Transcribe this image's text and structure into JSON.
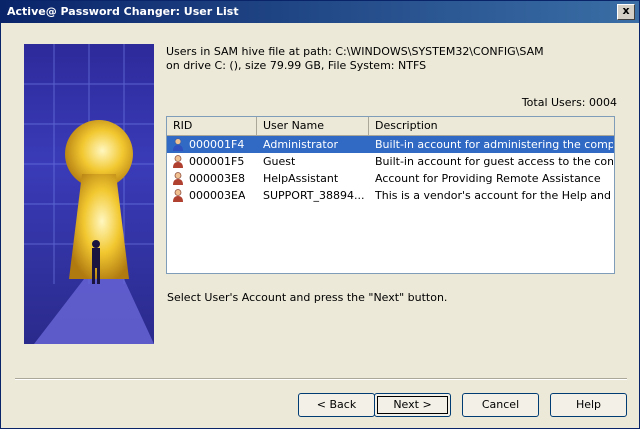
{
  "window": {
    "title": "Active@ Password Changer: User List",
    "close_label": "x"
  },
  "info": {
    "line1": "Users in SAM hive file at path: C:\\WINDOWS\\SYSTEM32\\CONFIG\\SAM",
    "line2": "on drive C: (), size 79.99 GB, File System: NTFS",
    "total": "Total Users: 0004"
  },
  "list": {
    "columns": [
      "RID",
      "User Name",
      "Description"
    ],
    "rows": [
      {
        "rid": "000001F4",
        "name": "Administrator",
        "desc": "Built-in account for administering the comput...",
        "icon": "user-admin-icon",
        "selected": true
      },
      {
        "rid": "000001F5",
        "name": "Guest",
        "desc": "Built-in account for guest access to the comp...",
        "icon": "user-icon",
        "selected": false
      },
      {
        "rid": "000003E8",
        "name": "HelpAssistant",
        "desc": "Account for Providing Remote Assistance",
        "icon": "user-icon",
        "selected": false
      },
      {
        "rid": "000003EA",
        "name": "SUPPORT_38894...",
        "desc": "This is a vendor's account for the Help and S...",
        "icon": "user-icon",
        "selected": false
      }
    ]
  },
  "hint": "Select User's Account and press the \"Next\" button.",
  "buttons": {
    "back": "< Back",
    "next": "Next >",
    "cancel": "Cancel",
    "help": "Help"
  },
  "colors": {
    "selection": "#316ac5",
    "title_start": "#0a246a",
    "title_end": "#3a6ea5"
  }
}
